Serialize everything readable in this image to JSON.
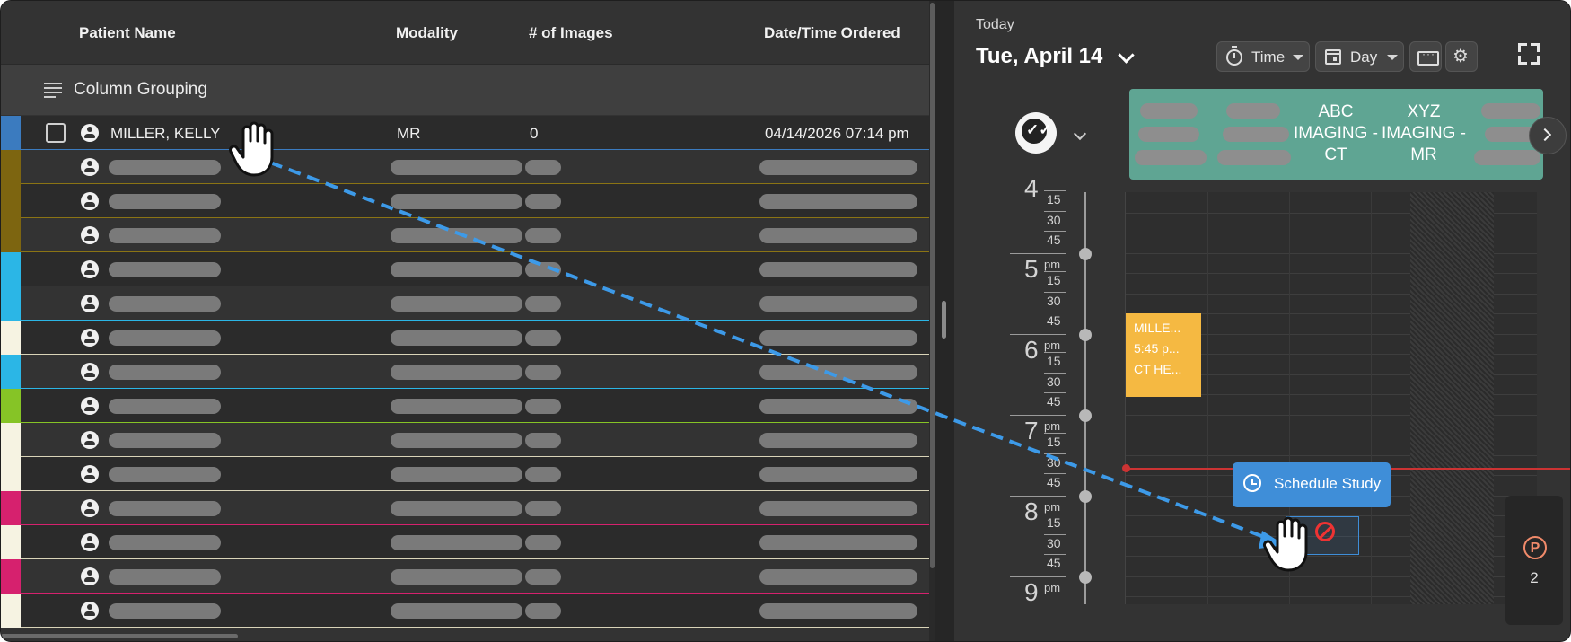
{
  "table": {
    "columns": [
      "Patient Name",
      "Modality",
      "# of Images",
      "Date/Time Ordered"
    ],
    "grouping_label": "Column Grouping",
    "first_row": {
      "name": "MILLER, KELLY",
      "modality": "MR",
      "images": "0",
      "ordered": "04/14/2026 07:14 pm"
    },
    "stripe_colors": [
      "#3b7bbf",
      "#7d6510",
      "#7d6510",
      "#7d6510",
      "#2bb6e6",
      "#2bb6e6",
      "#f6f3e2",
      "#2bb6e6",
      "#86c426",
      "#f6f3e2",
      "#f6f3e2",
      "#d6216e",
      "#f6f3e2",
      "#d6216e",
      "#f6f3e2"
    ],
    "line_colors": [
      "#3b7bbf",
      "#8b7414",
      "#8b7414",
      "#8b7414",
      "#2bb6e6",
      "#2bb6e6",
      "#d9d4b8",
      "#2bb6e6",
      "#86c426",
      "#d9d4b8",
      "#d9d4b8",
      "#d6216e",
      "#d9d4b8",
      "#d6216e",
      "#d9d4b8"
    ]
  },
  "calendar": {
    "today_label": "Today",
    "date": "Tue, April 14",
    "time_button": "Time",
    "day_button": "Day",
    "resource_ct": "ABC IMAGING -CT",
    "resource_mr": "XYZ IMAGING -MR",
    "hours": [
      "4",
      "5",
      "6",
      "7",
      "8",
      "9"
    ],
    "ampm": "pm",
    "quarters": [
      "15",
      "30",
      "45"
    ],
    "appointment": {
      "line1": "MILLE...",
      "line2": "5:45 p...",
      "line3": "CT HE..."
    },
    "schedule_button": "Schedule Study",
    "pending_badge": "P",
    "pending_count": "2"
  },
  "colors": {
    "accent": "#3f8ed8",
    "banner": "#5fa593",
    "appointment": "#f5b942",
    "now_line": "#cc3333"
  }
}
